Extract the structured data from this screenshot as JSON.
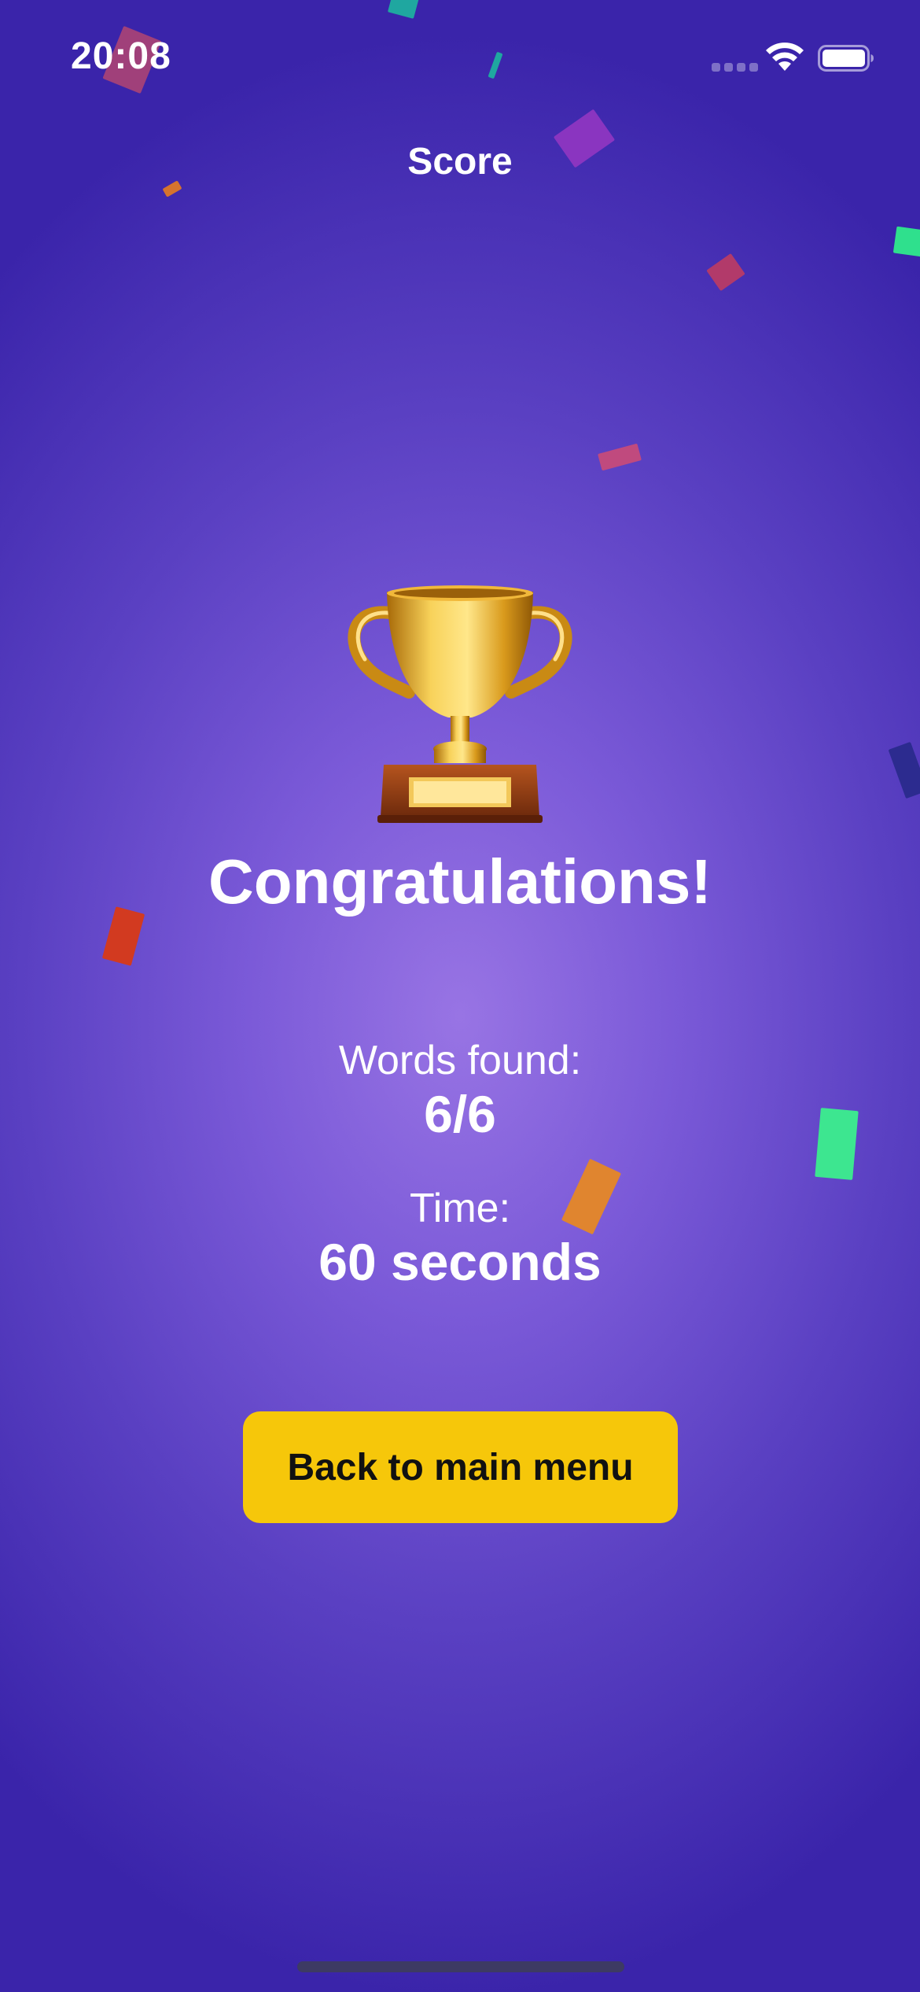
{
  "status_bar": {
    "time": "20:08"
  },
  "header": {
    "title": "Score"
  },
  "result": {
    "heading": "Congratulations!",
    "words_label": "Words found:",
    "words_value": "6/6",
    "time_label": "Time:",
    "time_value": "60 seconds"
  },
  "actions": {
    "back_label": "Back to main menu"
  },
  "colors": {
    "button": "#f6c70a",
    "background_center": "#9874e4",
    "background_edge": "#3a24aa"
  }
}
